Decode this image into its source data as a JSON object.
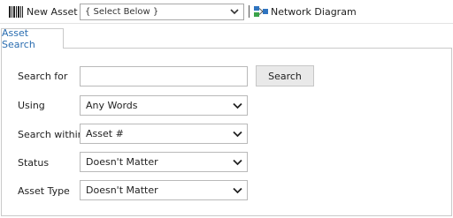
{
  "toolbar": {
    "new_asset_label": "New Asset",
    "new_asset_icon": "barcode-icon",
    "select_value": "{ Select Below }",
    "network_label": "Network Diagram",
    "network_icon": "network-diagram-icon"
  },
  "tabs": [
    {
      "label": "Asset Search",
      "active": true
    }
  ],
  "form": {
    "search_for": {
      "label": "Search for",
      "value": "",
      "placeholder": ""
    },
    "search_button": "Search",
    "using": {
      "label": "Using",
      "value": "Any Words"
    },
    "search_within": {
      "label": "Search within",
      "value": "Asset #"
    },
    "status": {
      "label": "Status",
      "value": "Doesn't Matter"
    },
    "asset_type": {
      "label": "Asset Type",
      "value": "Doesn't Matter"
    }
  },
  "colors": {
    "tab_text": "#2a6db0",
    "network_icon_blue": "#2f74c0",
    "network_icon_green": "#3aa34a"
  }
}
